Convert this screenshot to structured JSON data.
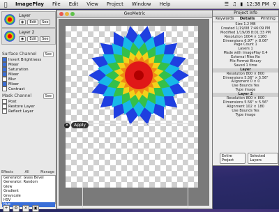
{
  "menubar": {
    "app_name": "ImagePlay",
    "items": [
      "File",
      "Edit",
      "View",
      "Project",
      "Window",
      "Help"
    ],
    "clock": "12:38 PM"
  },
  "layers": [
    {
      "name": "Layer",
      "edit_label": "Edit",
      "see_label": "See"
    },
    {
      "name": "Layer 2",
      "edit_label": "Edit",
      "see_label": "See"
    }
  ],
  "surface_channel": {
    "title": "Surface Channel",
    "see_label": "See",
    "options": [
      {
        "label": "Invert Brightness",
        "checked": true
      },
      {
        "label": "Mixer",
        "checked": true
      },
      {
        "label": "Saturation",
        "checked": true
      },
      {
        "label": "Mixer",
        "checked": true
      },
      {
        "label": "Blur",
        "checked": false
      },
      {
        "label": "Mixer",
        "checked": true
      },
      {
        "label": "Contrast",
        "checked": false
      }
    ]
  },
  "mask_channel": {
    "title": "Mask Channel",
    "see_label": "See",
    "options": [
      {
        "label": "Post",
        "checked": false
      },
      {
        "label": "Restore Layer",
        "checked": false
      },
      {
        "label": "Reflect Layer",
        "checked": false
      }
    ]
  },
  "effects": {
    "header_left": "Effects",
    "header_mid": "All",
    "header_right": "Manage",
    "items": [
      "Generator: Glass Bevel",
      "Generator: Random",
      "Glow",
      "Gradient",
      "Greyscale",
      "HSV",
      "Hue"
    ],
    "selected_index": 6
  },
  "document": {
    "title": "GeoMetric",
    "apply_label": "Apply"
  },
  "info_panel": {
    "title": "Project Info",
    "tabs": [
      "Keywords",
      "Details",
      "Printing"
    ],
    "active_tab": 1,
    "lines": [
      {
        "text": "Size 1.2 MB",
        "header": false
      },
      {
        "text": "Created 1/19/08 7:46:09 PM",
        "header": false
      },
      {
        "text": "Modified 1/19/08 8:01:33 PM",
        "header": false
      },
      {
        "text": "Resolution 1004 × 1160",
        "header": false
      },
      {
        "text": "Dimensions 6.97\" × 8.06\"",
        "header": false
      },
      {
        "text": "Page Count 1",
        "header": false
      },
      {
        "text": "Layers 1",
        "header": false
      },
      {
        "text": "Made with ImagePlay 0.4",
        "header": false
      },
      {
        "text": "External Files No",
        "header": false
      },
      {
        "text": "File Format Binary",
        "header": false
      },
      {
        "text": "Saved 1 time",
        "header": false
      },
      {
        "text": "Layer",
        "header": true
      },
      {
        "text": "Resolution 800 × 800",
        "header": false
      },
      {
        "text": "Dimensions 5.56\" × 5.56\"",
        "header": false
      },
      {
        "text": "Alignment 0 × 0",
        "header": false
      },
      {
        "text": "Use Bounds Yes",
        "header": false
      },
      {
        "text": "Type Image",
        "header": false
      },
      {
        "text": "Layer 2",
        "header": true
      },
      {
        "text": "Resolution 800 × 800",
        "header": false
      },
      {
        "text": "Dimensions 5.56\" × 5.56\"",
        "header": false
      },
      {
        "text": "Alignment 102 × 180",
        "header": false
      },
      {
        "text": "Use Bounds Yes",
        "header": false
      },
      {
        "text": "Type Image",
        "header": false
      }
    ],
    "buttons": [
      "Entire Project",
      "Selected Layers"
    ]
  },
  "colors": {
    "selection": "#3a6fd8",
    "desktop": "#2c2a6a"
  }
}
